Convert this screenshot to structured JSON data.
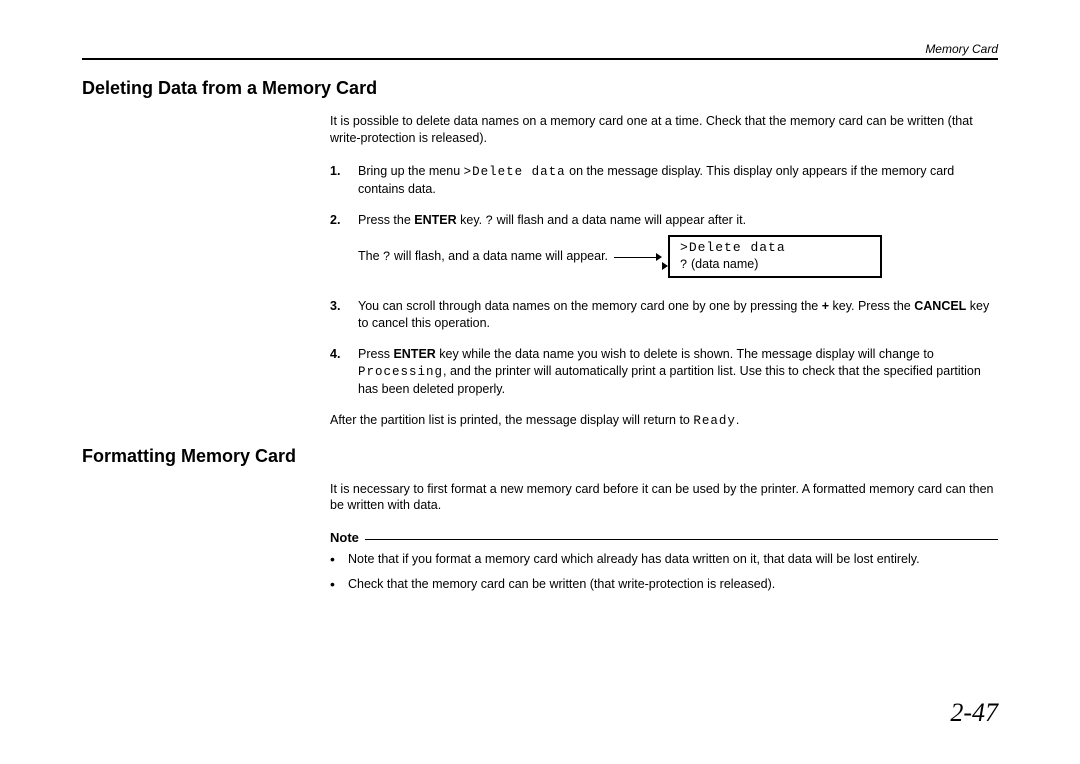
{
  "header": {
    "breadcrumb": "Memory Card"
  },
  "section1": {
    "title": "Deleting Data from a Memory Card",
    "intro": "It is possible to delete data names on a memory card one at a time.  Check that the memory card can  be written (that write-protection is released).",
    "steps": {
      "s1_num": "1.",
      "s1_a": "Bring up the menu ",
      "s1_code": ">Delete data",
      "s1_b": " on the message display.  This display only appears if the memory card contains data.",
      "s2_num": "2.",
      "s2_a": "Press the ",
      "s2_enter": "ENTER",
      "s2_b": " key. ",
      "s2_q": "?",
      "s2_c": " will flash and a data name will appear after it.",
      "s2_caption_a": "The ",
      "s2_caption_q": "?",
      "s2_caption_b": " will flash, and a data name will appear.",
      "lcd_line1": ">Delete data",
      "lcd_q": "?",
      "lcd_line2": " (data name)",
      "s3_num": "3.",
      "s3_a": "You can scroll through data names on the memory card one by one by pressing the ",
      "s3_plus": "+",
      "s3_b": " key. Press the ",
      "s3_cancel": "CANCEL",
      "s3_c": " key to cancel this operation.",
      "s4_num": "4.",
      "s4_a": "Press ",
      "s4_enter": "ENTER",
      "s4_b": " key while the data name you wish to delete is shown.  The message display will change to ",
      "s4_code": "Processing",
      "s4_c": ", and the printer will automatically print a partition list.  Use this to check that the specified partition has been deleted properly."
    },
    "outro_a": "After the partition list is printed, the message display will return to ",
    "outro_code": "Ready",
    "outro_b": "."
  },
  "section2": {
    "title": "Formatting Memory Card",
    "intro": "It is necessary to first format a new memory card before it can be used by the printer.  A formatted memory card can then be written with data.",
    "note_label": "Note",
    "bullets": {
      "b1": "Note that if you format a memory card which already has data written on it, that data will be lost entirely.",
      "b2": "Check that the memory card can be written (that write-protection is released)."
    }
  },
  "footer": {
    "page": "2-47"
  }
}
